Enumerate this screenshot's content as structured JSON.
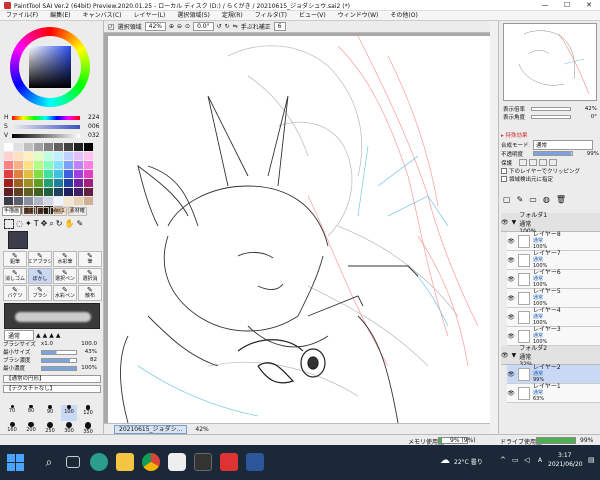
{
  "window": {
    "title": "PaintTool SAI Ver.2 (64bit) Preview.2020.01.25 - ローカル ディスク (D:) / らくがき / 20210615_ジョダシュウ.sai2 (*)",
    "minimize": "—",
    "maximize": "☐",
    "close": "✕"
  },
  "menu": [
    "ファイル(F)",
    "編集(E)",
    "キャンバス(C)",
    "レイヤー(L)",
    "選択領域(S)",
    "定規(R)",
    "フィルタ(T)",
    "ビュー(V)",
    "ウィンドウ(W)",
    "その他(O)"
  ],
  "toolbar": {
    "select_label": "選択領域",
    "zoom": "42%",
    "angle": "0.0°",
    "stabilizer_label": "手ぶれ補正",
    "stabilizer": "6"
  },
  "color": {
    "h_label": "H",
    "h_value": "224",
    "s_label": "S",
    "s_value": "006",
    "v_label": "V",
    "v_value": "032",
    "current": "#3b3e4a"
  },
  "tool_tabs": [
    "手描画",
    "基本",
    "2値",
    "Ver.1",
    "素材確"
  ],
  "tools": [
    "鉛筆",
    "エアブラシ",
    "水彩筆",
    "筆",
    "消しゴム",
    "ぼかし",
    "選択ペン",
    "選択消",
    "バケツ",
    "ブラシ",
    "水彩ペン",
    "散布"
  ],
  "brush": {
    "mode": "通常",
    "size_label": "ブラシサイズ",
    "size_mult": "x1.0",
    "size": "100.0",
    "min_size_label": "最小サイズ",
    "min_size": "43%",
    "density_label": "ブラシ濃度",
    "density": "82",
    "min_density_label": "最小濃度",
    "min_density": "100%",
    "shape_label": "【通常の円形】",
    "texture_label": "【テクスチャなし】"
  },
  "brush_sizes": [
    [
      "70",
      "80",
      "90",
      "100",
      "120"
    ],
    [
      "160",
      "200",
      "250",
      "300",
      "350"
    ],
    [
      "400",
      "450",
      "500",
      "600",
      "700"
    ],
    [
      "800",
      "1000",
      "1200",
      "1500",
      "2000"
    ]
  ],
  "navigator": {
    "zoom_label": "表示倍率",
    "zoom": "42%",
    "angle_label": "表示角度",
    "angle": "0°"
  },
  "layer_props": {
    "section": "特殊効果",
    "blend_label": "合成モード",
    "blend": "通常",
    "opacity_label": "不透明度",
    "opacity": "99%",
    "protect_label": "保護",
    "clip_label": "下のレイヤーでクリッピング",
    "ref_label": "領域検出元に指定"
  },
  "layers": [
    {
      "name": "フォルダ1",
      "mode": "通常",
      "opacity": "100%",
      "folder": true
    },
    {
      "name": "レイヤー8",
      "mode": "通常",
      "opacity": "100%"
    },
    {
      "name": "レイヤー7",
      "mode": "通常",
      "opacity": "100%"
    },
    {
      "name": "レイヤー6",
      "mode": "通常",
      "opacity": "100%"
    },
    {
      "name": "レイヤー5",
      "mode": "通常",
      "opacity": "100%"
    },
    {
      "name": "レイヤー4",
      "mode": "通常",
      "opacity": "100%"
    },
    {
      "name": "レイヤー3",
      "mode": "通常",
      "opacity": "100%"
    },
    {
      "name": "フォルダ2",
      "mode": "通常",
      "opacity": "32%",
      "folder": true
    },
    {
      "name": "レイヤー2",
      "mode": "通常",
      "opacity": "99%",
      "selected": true
    },
    {
      "name": "レイヤー1",
      "mode": "通常",
      "opacity": "63%"
    }
  ],
  "document_tab": {
    "name": "20210615_ジョダシ...",
    "zoom": "42%"
  },
  "status": {
    "mem_label": "メモリ使用量",
    "mem_value": "9% (9%)",
    "mem_pct": 0.09,
    "drive_label": "ドライブ使用量",
    "drive_value": "99%",
    "drive_pct": 0.99
  },
  "taskbar": {
    "weather": "22°C 曇り",
    "time": "3:17",
    "date": "2021/06/20",
    "ime": "A"
  },
  "colors": {
    "accent": "#3a78d8",
    "selected_layer": "#c9d8f4",
    "taskbar": "#1b2838"
  }
}
